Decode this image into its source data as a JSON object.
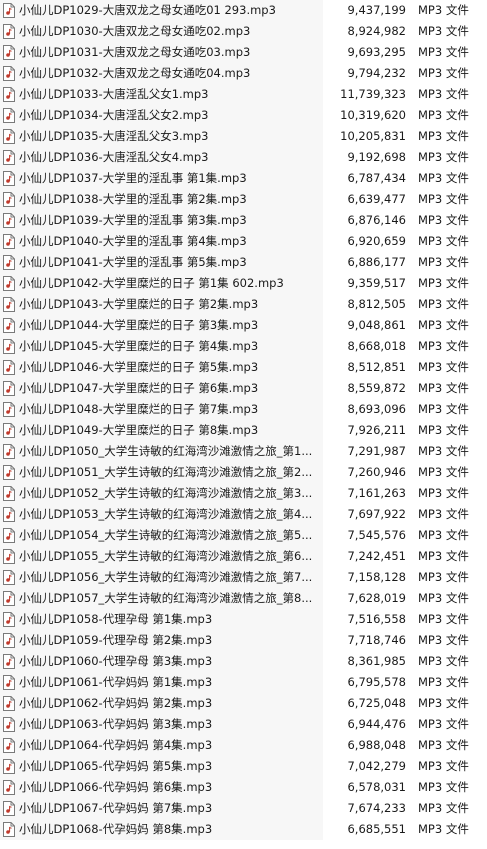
{
  "files": [
    {
      "name": "小仙儿DP1029-大唐双龙之母女通吃01 293.mp3",
      "size": "9,437,199",
      "type": "MP3 文件"
    },
    {
      "name": "小仙儿DP1030-大唐双龙之母女通吃02.mp3",
      "size": "8,924,982",
      "type": "MP3 文件"
    },
    {
      "name": "小仙儿DP1031-大唐双龙之母女通吃03.mp3",
      "size": "9,693,295",
      "type": "MP3 文件"
    },
    {
      "name": "小仙儿DP1032-大唐双龙之母女通吃04.mp3",
      "size": "9,794,232",
      "type": "MP3 文件"
    },
    {
      "name": "小仙儿DP1033-大唐淫乱父女1.mp3",
      "size": "11,739,323",
      "type": "MP3 文件"
    },
    {
      "name": "小仙儿DP1034-大唐淫乱父女2.mp3",
      "size": "10,319,620",
      "type": "MP3 文件"
    },
    {
      "name": "小仙儿DP1035-大唐淫乱父女3.mp3",
      "size": "10,205,831",
      "type": "MP3 文件"
    },
    {
      "name": "小仙儿DP1036-大唐淫乱父女4.mp3",
      "size": "9,192,698",
      "type": "MP3 文件"
    },
    {
      "name": "小仙儿DP1037-大学里的淫乱事 第1集.mp3",
      "size": "6,787,434",
      "type": "MP3 文件"
    },
    {
      "name": "小仙儿DP1038-大学里的淫乱事 第2集.mp3",
      "size": "6,639,477",
      "type": "MP3 文件"
    },
    {
      "name": "小仙儿DP1039-大学里的淫乱事 第3集.mp3",
      "size": "6,876,146",
      "type": "MP3 文件"
    },
    {
      "name": "小仙儿DP1040-大学里的淫乱事 第4集.mp3",
      "size": "6,920,659",
      "type": "MP3 文件"
    },
    {
      "name": "小仙儿DP1041-大学里的淫乱事 第5集.mp3",
      "size": "6,886,177",
      "type": "MP3 文件"
    },
    {
      "name": "小仙儿DP1042-大学里糜烂的日子 第1集 602.mp3",
      "size": "9,359,517",
      "type": "MP3 文件"
    },
    {
      "name": "小仙儿DP1043-大学里糜烂的日子 第2集.mp3",
      "size": "8,812,505",
      "type": "MP3 文件"
    },
    {
      "name": "小仙儿DP1044-大学里糜烂的日子 第3集.mp3",
      "size": "9,048,861",
      "type": "MP3 文件"
    },
    {
      "name": "小仙儿DP1045-大学里糜烂的日子 第4集.mp3",
      "size": "8,668,018",
      "type": "MP3 文件"
    },
    {
      "name": "小仙儿DP1046-大学里糜烂的日子 第5集.mp3",
      "size": "8,512,851",
      "type": "MP3 文件"
    },
    {
      "name": "小仙儿DP1047-大学里糜烂的日子 第6集.mp3",
      "size": "8,559,872",
      "type": "MP3 文件"
    },
    {
      "name": "小仙儿DP1048-大学里糜烂的日子 第7集.mp3",
      "size": "8,693,096",
      "type": "MP3 文件"
    },
    {
      "name": "小仙儿DP1049-大学里糜烂的日子 第8集.mp3",
      "size": "7,926,211",
      "type": "MP3 文件"
    },
    {
      "name": "小仙儿DP1050_大学生诗敏的红海湾沙滩激情之旅_第1...",
      "size": "7,291,987",
      "type": "MP3 文件"
    },
    {
      "name": "小仙儿DP1051_大学生诗敏的红海湾沙滩激情之旅_第2...",
      "size": "7,260,946",
      "type": "MP3 文件"
    },
    {
      "name": "小仙儿DP1052_大学生诗敏的红海湾沙滩激情之旅_第3...",
      "size": "7,161,263",
      "type": "MP3 文件"
    },
    {
      "name": "小仙儿DP1053_大学生诗敏的红海湾沙滩激情之旅_第4...",
      "size": "7,697,922",
      "type": "MP3 文件"
    },
    {
      "name": "小仙儿DP1054_大学生诗敏的红海湾沙滩激情之旅_第5...",
      "size": "7,545,576",
      "type": "MP3 文件"
    },
    {
      "name": "小仙儿DP1055_大学生诗敏的红海湾沙滩激情之旅_第6...",
      "size": "7,242,451",
      "type": "MP3 文件"
    },
    {
      "name": "小仙儿DP1056_大学生诗敏的红海湾沙滩激情之旅_第7...",
      "size": "7,158,128",
      "type": "MP3 文件"
    },
    {
      "name": "小仙儿DP1057_大学生诗敏的红海湾沙滩激情之旅_第8...",
      "size": "7,628,019",
      "type": "MP3 文件"
    },
    {
      "name": "小仙儿DP1058-代理孕母 第1集.mp3",
      "size": "7,516,558",
      "type": "MP3 文件"
    },
    {
      "name": "小仙儿DP1059-代理孕母 第2集.mp3",
      "size": "7,718,746",
      "type": "MP3 文件"
    },
    {
      "name": "小仙儿DP1060-代理孕母 第3集.mp3",
      "size": "8,361,985",
      "type": "MP3 文件"
    },
    {
      "name": "小仙儿DP1061-代孕妈妈 第1集.mp3",
      "size": "6,795,578",
      "type": "MP3 文件"
    },
    {
      "name": "小仙儿DP1062-代孕妈妈 第2集.mp3",
      "size": "6,725,048",
      "type": "MP3 文件"
    },
    {
      "name": "小仙儿DP1063-代孕妈妈 第3集.mp3",
      "size": "6,944,476",
      "type": "MP3 文件"
    },
    {
      "name": "小仙儿DP1064-代孕妈妈 第4集.mp3",
      "size": "6,988,048",
      "type": "MP3 文件"
    },
    {
      "name": "小仙儿DP1065-代孕妈妈 第5集.mp3",
      "size": "7,042,279",
      "type": "MP3 文件"
    },
    {
      "name": "小仙儿DP1066-代孕妈妈 第6集.mp3",
      "size": "6,578,031",
      "type": "MP3 文件"
    },
    {
      "name": "小仙儿DP1067-代孕妈妈 第7集.mp3",
      "size": "7,674,233",
      "type": "MP3 文件"
    },
    {
      "name": "小仙儿DP1068-代孕妈妈 第8集.mp3",
      "size": "6,685,551",
      "type": "MP3 文件"
    }
  ],
  "colors": {
    "name_cell_bg": "#f7f7f7",
    "text": "#1a1a1a",
    "icon_border": "#7a7a7a",
    "icon_fill": "#ffffff",
    "icon_accent": "#c0392b"
  },
  "icons": {
    "file": "mp3-file-icon"
  }
}
